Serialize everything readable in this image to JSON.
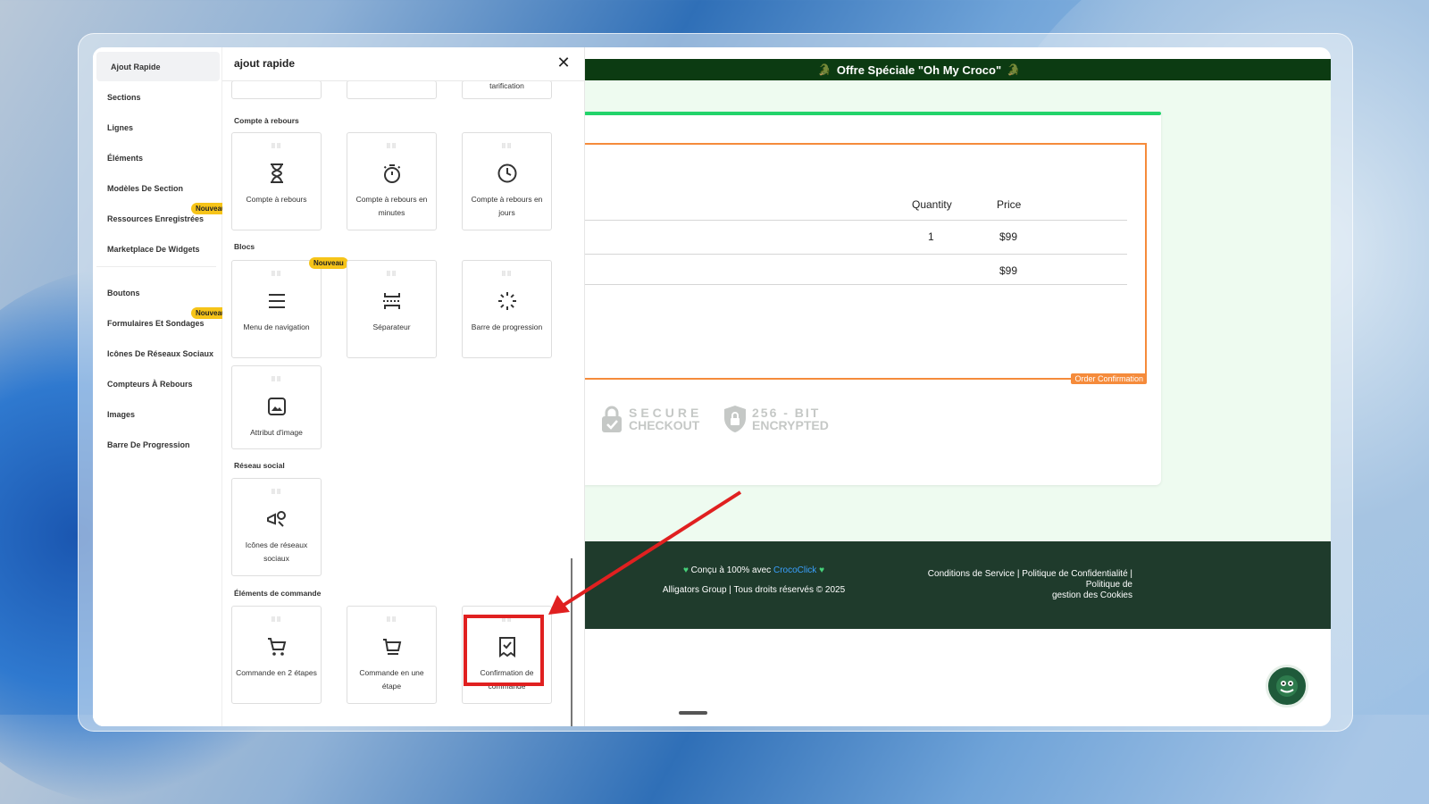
{
  "banner": {
    "text": "Offre Spéciale \"Oh My Croco\"",
    "emoji": "🐊"
  },
  "order_table": {
    "headers": [
      "Quantity",
      "Price"
    ],
    "rows": [
      {
        "quantity": "1",
        "price": "$99"
      }
    ],
    "total": "$99",
    "tag": "Order Confirmation"
  },
  "badges": [
    {
      "line1": "SECURE",
      "line2": "CHECKOUT"
    },
    {
      "line1": "256 - BIT",
      "line2": "ENCRYPTED"
    }
  ],
  "footer": {
    "made_prefix": "Conçu à 100% avec",
    "brand": "CrocoClick",
    "copyright": "Alligators Group | Tous droits réservés © 2025",
    "links_line1": "Conditions de Service | Politique de Confidentialité | Politique de",
    "links_line2": "gestion des Cookies"
  },
  "nav": {
    "items": [
      "Ajout Rapide",
      "Sections",
      "Lignes",
      "Éléments",
      "Modèles De Section",
      "Ressources Enregistrées",
      "Marketplace De Widgets",
      "Boutons",
      "Formulaires Et Sondages",
      "Icônes De Réseaux Sociaux",
      "Compteurs À Rebours",
      "Images",
      "Barre De Progression"
    ],
    "new_badge": "Nouveau"
  },
  "panel": {
    "title": "ajout rapide",
    "partial_tiles": [
      "",
      "",
      "tarification"
    ],
    "sections": {
      "countdown": "Compte à rebours",
      "blocks": "Blocs",
      "social": "Réseau social",
      "order": "Éléments de commande"
    },
    "tiles": {
      "countdown": [
        "Compte à rebours",
        "Compte à rebours en minutes",
        "Compte à rebours en jours"
      ],
      "blocks": [
        "Menu de navigation",
        "Séparateur",
        "Barre de progression",
        "Attribut d'image"
      ],
      "social": [
        "Icônes de réseaux sociaux"
      ],
      "order": [
        "Commande en 2 étapes",
        "Commande en une étape",
        "Confirmation de commande"
      ]
    }
  },
  "colors": {
    "banner_bg": "#0c3b12",
    "accent_orange": "#f58b3b",
    "highlight_red": "#e02020",
    "footer_bg": "#1f3b2c"
  }
}
